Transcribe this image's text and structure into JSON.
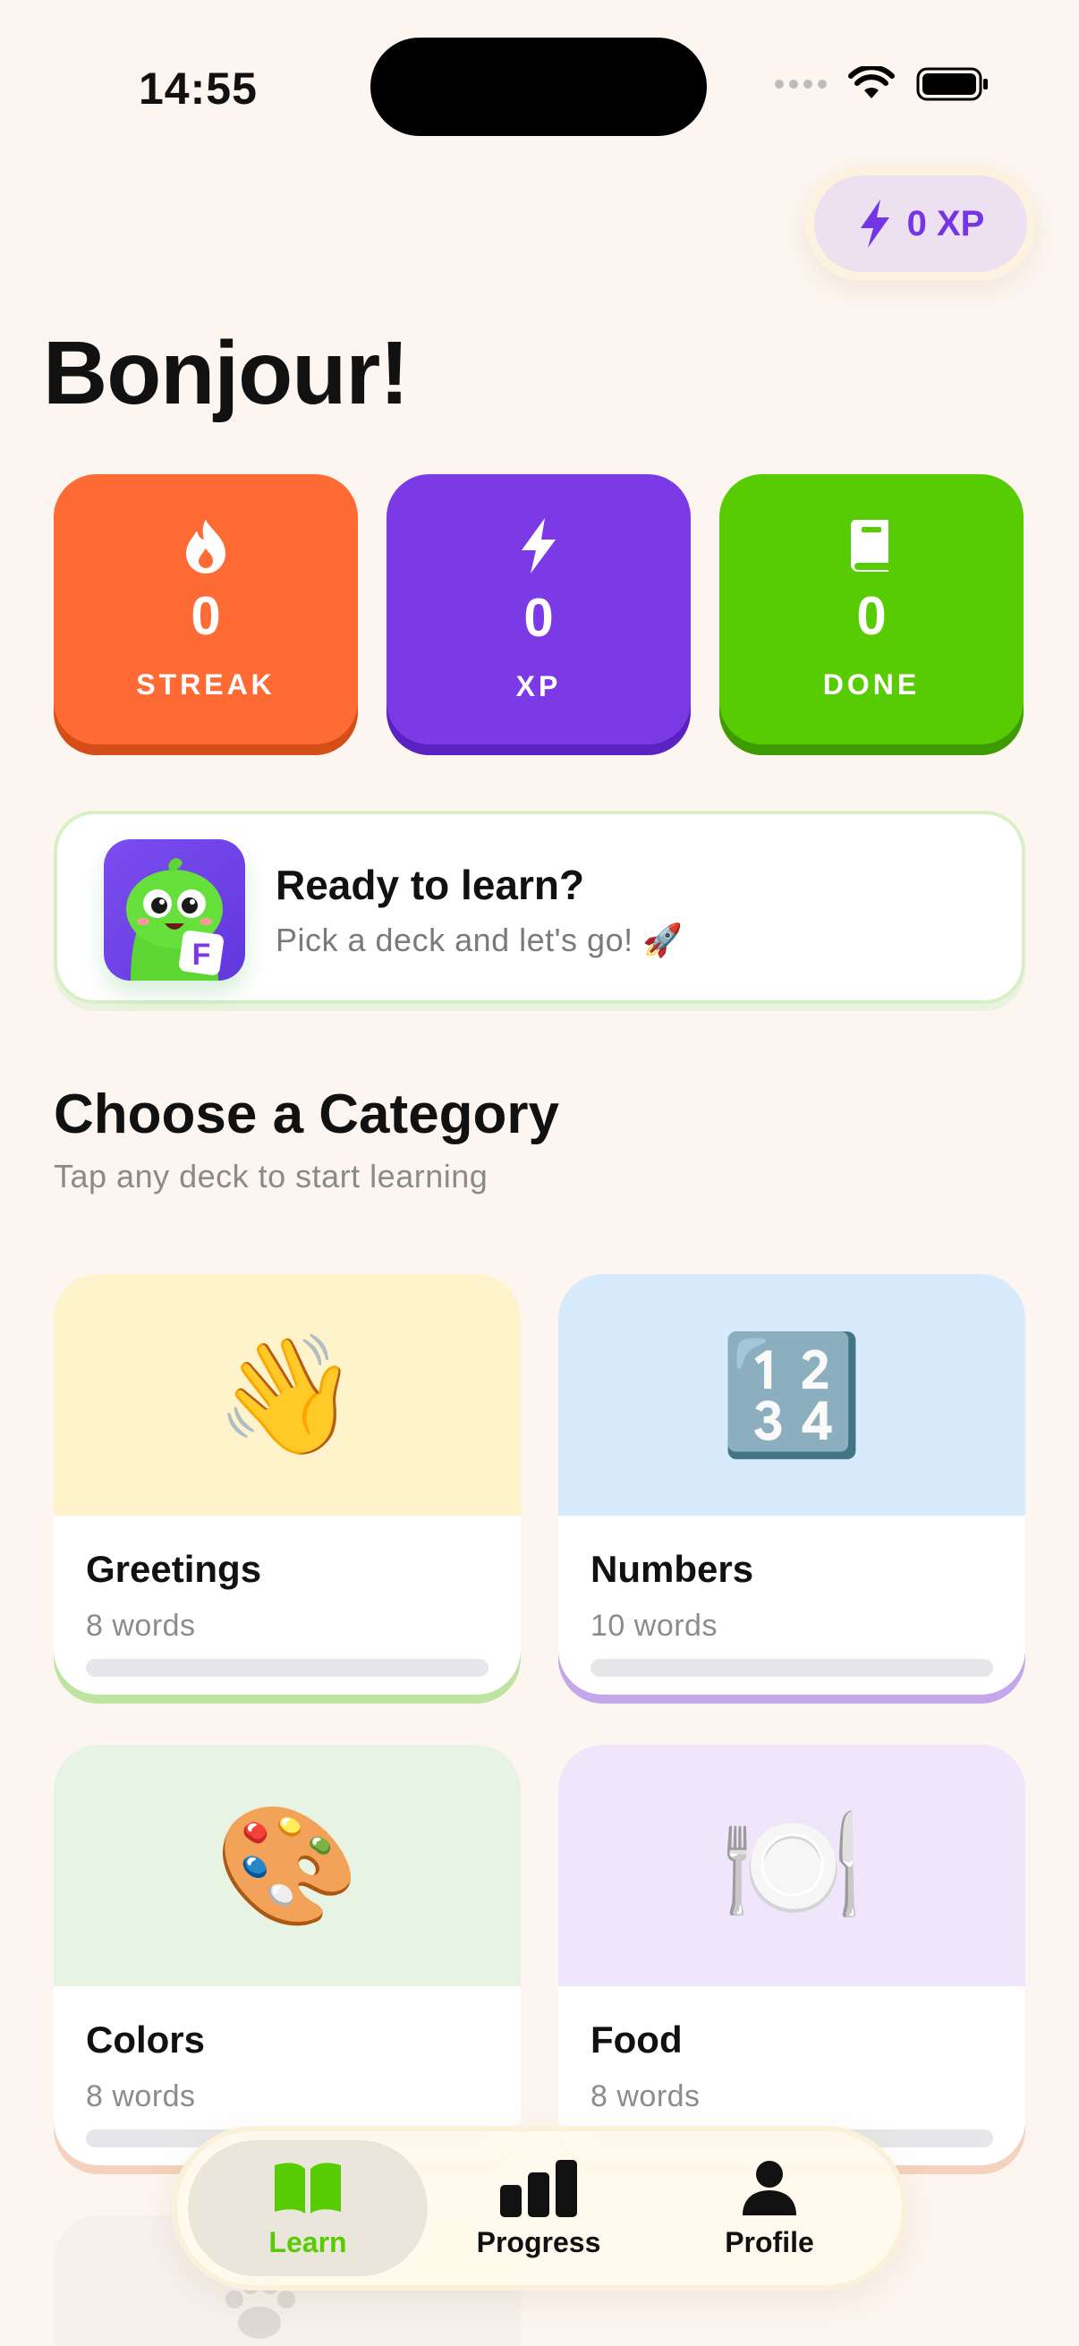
{
  "status_bar": {
    "time": "14:55"
  },
  "xp_pill": {
    "label": "0 XP"
  },
  "greeting": "Bonjour!",
  "stats": [
    {
      "value": "0",
      "label": "STREAK",
      "icon": "flame-icon",
      "color": "#ff6b35"
    },
    {
      "value": "0",
      "label": "XP",
      "icon": "bolt-icon",
      "color": "#7b3ae6"
    },
    {
      "value": "0",
      "label": "DONE",
      "icon": "book-icon",
      "color": "#58cc02"
    }
  ],
  "banner": {
    "title": "Ready to learn?",
    "subtitle": "Pick a deck and let's go! 🚀",
    "mascot_letter": "F"
  },
  "section": {
    "title": "Choose a Category",
    "subtitle": "Tap any deck to start learning"
  },
  "decks": [
    {
      "name": "Greetings",
      "count": "8 words",
      "emoji": "👋",
      "bg": "#fff3cc",
      "progress": 0
    },
    {
      "name": "Numbers",
      "count": "10 words",
      "emoji": "🔢",
      "bg": "#d7ebfc",
      "progress": 0
    },
    {
      "name": "Colors",
      "count": "8 words",
      "emoji": "🎨",
      "bg": "#e7f4e4",
      "progress": 0
    },
    {
      "name": "Food",
      "count": "8 words",
      "emoji": "🍽️",
      "bg": "#efe6fb",
      "progress": 0
    }
  ],
  "tabs": [
    {
      "label": "Learn",
      "icon": "open-book-icon",
      "active": true
    },
    {
      "label": "Progress",
      "icon": "bar-chart-icon",
      "active": false
    },
    {
      "label": "Profile",
      "icon": "person-icon",
      "active": false
    }
  ]
}
